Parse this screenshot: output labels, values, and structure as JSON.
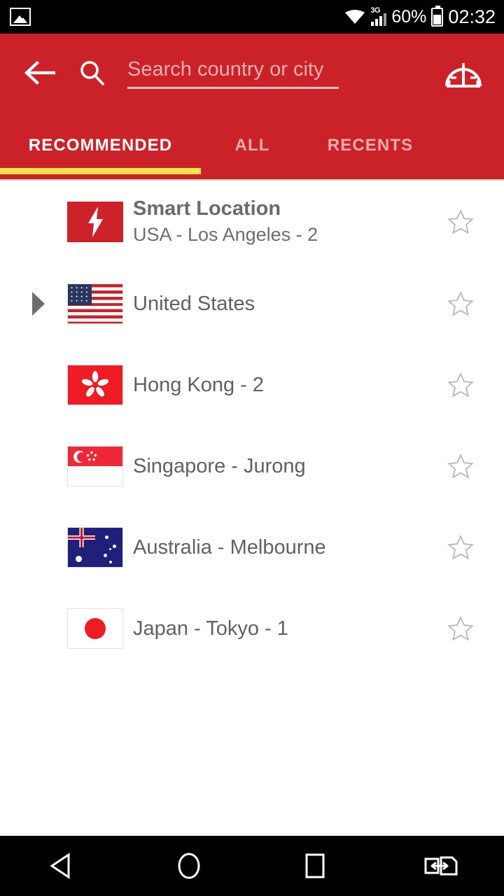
{
  "status_bar": {
    "notification_icon": "photo-icon",
    "wifi_icon": "wifi-icon",
    "network_type": "3G",
    "battery_percent": "60%",
    "battery_icon": "battery-icon",
    "time": "02:32"
  },
  "toolbar": {
    "back_icon": "arrow-left-icon",
    "search_icon": "search-icon",
    "search_placeholder": "Search country or city",
    "search_value": "",
    "speed_test_icon": "speedometer-icon",
    "background_color": "#cb2229"
  },
  "tabs": {
    "indicator_color": "#fae04f",
    "items": [
      {
        "label": "RECOMMENDED",
        "active": true
      },
      {
        "label": "ALL",
        "active": false
      },
      {
        "label": "RECENTS",
        "active": false
      }
    ]
  },
  "list": {
    "rows": [
      {
        "id": "smart-location",
        "title": "Smart Location",
        "subtitle": "USA - Los Angeles - 2",
        "flag": "smart-bolt-icon",
        "expandable": false,
        "favorite_icon": "star-outline-icon"
      },
      {
        "id": "united-states",
        "title": "United States",
        "subtitle": "",
        "flag": "flag-united-states",
        "expandable": true,
        "favorite_icon": "star-outline-icon"
      },
      {
        "id": "hong-kong",
        "title": "Hong Kong - 2",
        "subtitle": "",
        "flag": "flag-hong-kong",
        "expandable": false,
        "favorite_icon": "star-outline-icon"
      },
      {
        "id": "singapore-jurong",
        "title": "Singapore - Jurong",
        "subtitle": "",
        "flag": "flag-singapore",
        "expandable": false,
        "favorite_icon": "star-outline-icon"
      },
      {
        "id": "australia-melbourne",
        "title": "Australia - Melbourne",
        "subtitle": "",
        "flag": "flag-australia",
        "expandable": false,
        "favorite_icon": "star-outline-icon"
      },
      {
        "id": "japan-tokyo",
        "title": "Japan - Tokyo - 1",
        "subtitle": "",
        "flag": "flag-japan",
        "expandable": false,
        "favorite_icon": "star-outline-icon"
      }
    ]
  },
  "navigation_bar": {
    "back": "triangle-back-icon",
    "home": "circle-home-icon",
    "recents": "square-recents-icon",
    "switch": "app-switch-icon"
  }
}
